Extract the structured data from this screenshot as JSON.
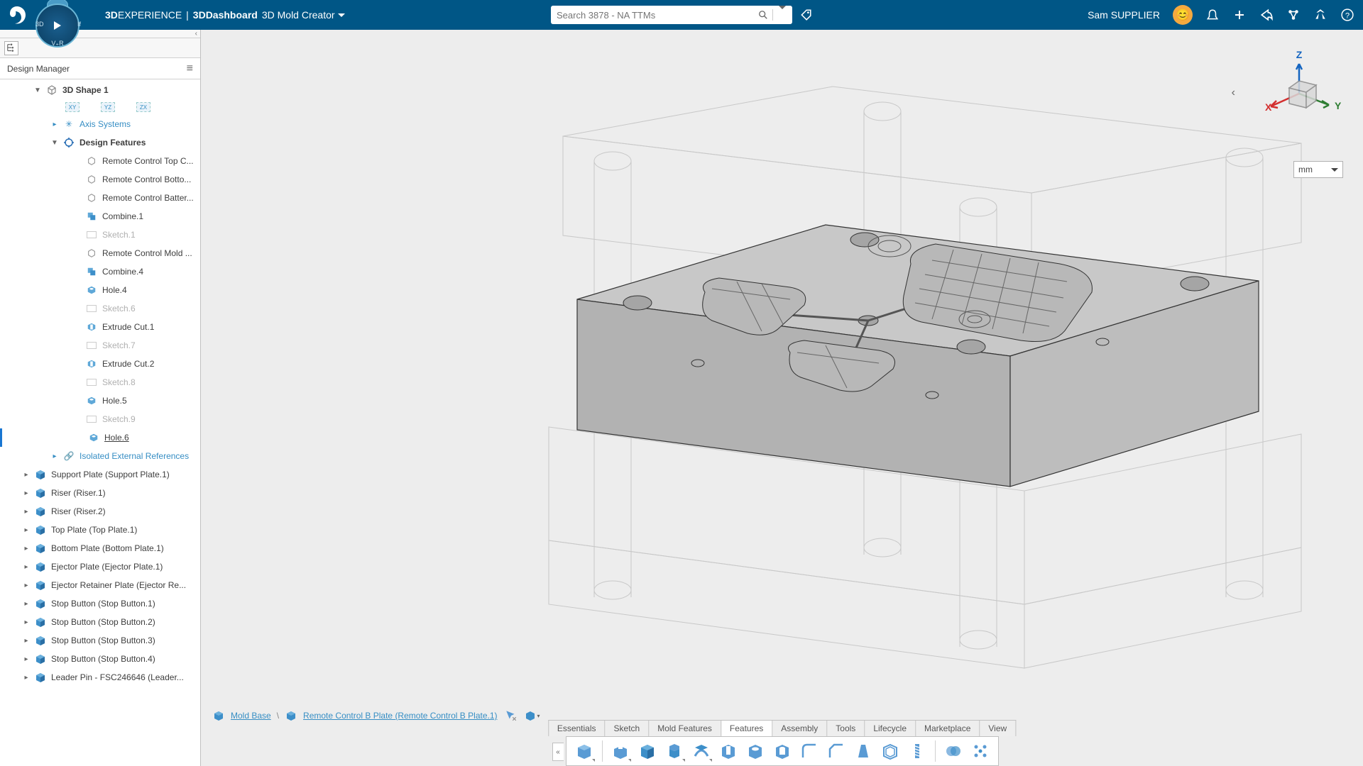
{
  "header": {
    "brand_prefix": "3D",
    "brand_main": "EXPERIENCE",
    "dashboard": "3DDashboard",
    "app_name": "3D Mold Creator",
    "search_placeholder": "Search 3878 - NA TTMs",
    "user_name": "Sam SUPPLIER"
  },
  "sidebar": {
    "title": "Design Manager",
    "root": "3D Shape 1",
    "planes": [
      "XY",
      "YZ",
      "ZX"
    ],
    "axis_systems": "Axis Systems",
    "design_features": "Design Features",
    "features": [
      {
        "label": "Remote Control Top C...",
        "type": "geom"
      },
      {
        "label": "Remote Control Botto...",
        "type": "geom"
      },
      {
        "label": "Remote Control Batter...",
        "type": "geom"
      },
      {
        "label": "Combine.1",
        "type": "combine"
      },
      {
        "label": "Sketch.1",
        "type": "sketch"
      },
      {
        "label": "Remote Control Mold ...",
        "type": "geom"
      },
      {
        "label": "Combine.4",
        "type": "combine"
      },
      {
        "label": "Hole.4",
        "type": "hole"
      },
      {
        "label": "Sketch.6",
        "type": "sketch"
      },
      {
        "label": "Extrude Cut.1",
        "type": "cut"
      },
      {
        "label": "Sketch.7",
        "type": "sketch"
      },
      {
        "label": "Extrude Cut.2",
        "type": "cut"
      },
      {
        "label": "Sketch.8",
        "type": "sketch"
      },
      {
        "label": "Hole.5",
        "type": "hole"
      },
      {
        "label": "Sketch.9",
        "type": "sketch"
      },
      {
        "label": "Hole.6",
        "type": "hole",
        "active": true
      }
    ],
    "ext_refs": "Isolated External References",
    "parts": [
      "Support Plate (Support Plate.1)",
      "Riser (Riser.1)",
      "Riser (Riser.2)",
      "Top Plate (Top Plate.1)",
      "Bottom Plate (Bottom Plate.1)",
      "Ejector Plate (Ejector Plate.1)",
      "Ejector Retainer Plate (Ejector Re...",
      "Stop Button (Stop Button.1)",
      "Stop Button (Stop Button.2)",
      "Stop Button (Stop Button.3)",
      "Stop Button (Stop Button.4)",
      "Leader Pin - FSC246646 (Leader..."
    ]
  },
  "viewport": {
    "unit": "mm",
    "axes": {
      "x": "X",
      "y": "Y",
      "z": "Z"
    }
  },
  "breadcrumb": {
    "root": "Mold Base",
    "current": "Remote Control B Plate (Remote Control B Plate.1)"
  },
  "tabs": [
    "Essentials",
    "Sketch",
    "Mold Features",
    "Features",
    "Assembly",
    "Tools",
    "Lifecycle",
    "Marketplace",
    "View"
  ],
  "active_tab": "Features",
  "toolbar": {
    "tools": [
      {
        "name": "box-new",
        "dd": true
      },
      {
        "name": "extrude",
        "dd": true
      },
      {
        "name": "box-solid",
        "dd": false
      },
      {
        "name": "revolve",
        "dd": true
      },
      {
        "name": "sweep",
        "dd": true
      },
      {
        "name": "cut-extrude",
        "dd": false
      },
      {
        "name": "cut-revolve",
        "dd": false
      },
      {
        "name": "hole",
        "dd": false
      },
      {
        "name": "fillet",
        "dd": false
      },
      {
        "name": "chamfer",
        "dd": false
      },
      {
        "name": "draft",
        "dd": false
      },
      {
        "name": "shell",
        "dd": false
      },
      {
        "name": "thread",
        "dd": false
      },
      {
        "name": "boolean",
        "dd": false
      },
      {
        "name": "pattern",
        "dd": false
      }
    ],
    "separators_after": [
      0,
      12
    ]
  }
}
